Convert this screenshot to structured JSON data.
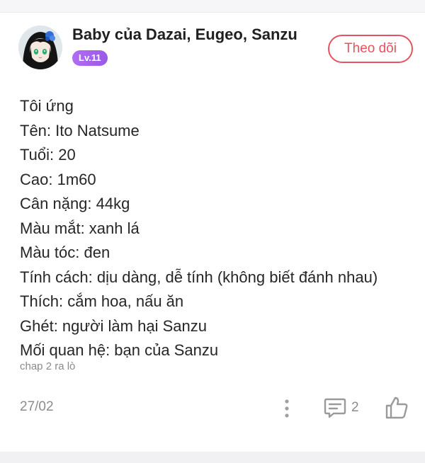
{
  "post": {
    "author": {
      "name": "Baby của Dazai, Eugeo, Sanzu",
      "level": "Lv.11"
    },
    "follow_label": "Theo dõi",
    "lines": [
      "Tôi ứng",
      "Tên: Ito Natsume",
      "Tuổi: 20",
      "Cao: 1m60",
      "Cân nặng: 44kg",
      "Màu mắt: xanh lá",
      "Màu tóc: đen",
      "Tính cách: dịu dàng, dễ tính (không biết đánh nhau)",
      "Thích: cắm hoa, nấu ăn",
      "Ghét: người làm hại Sanzu",
      "Mối quan hệ: bạn của Sanzu"
    ],
    "chapter_note": "chap 2 ra lò",
    "date": "27/02",
    "comment_count": "2"
  },
  "icons": {
    "more": "more-vertical-icon",
    "comment": "comment-icon",
    "like": "thumbs-up-icon"
  },
  "colors": {
    "accent": "#e4535f",
    "level_badge": "#a863ee",
    "muted": "#8c8c8c"
  }
}
